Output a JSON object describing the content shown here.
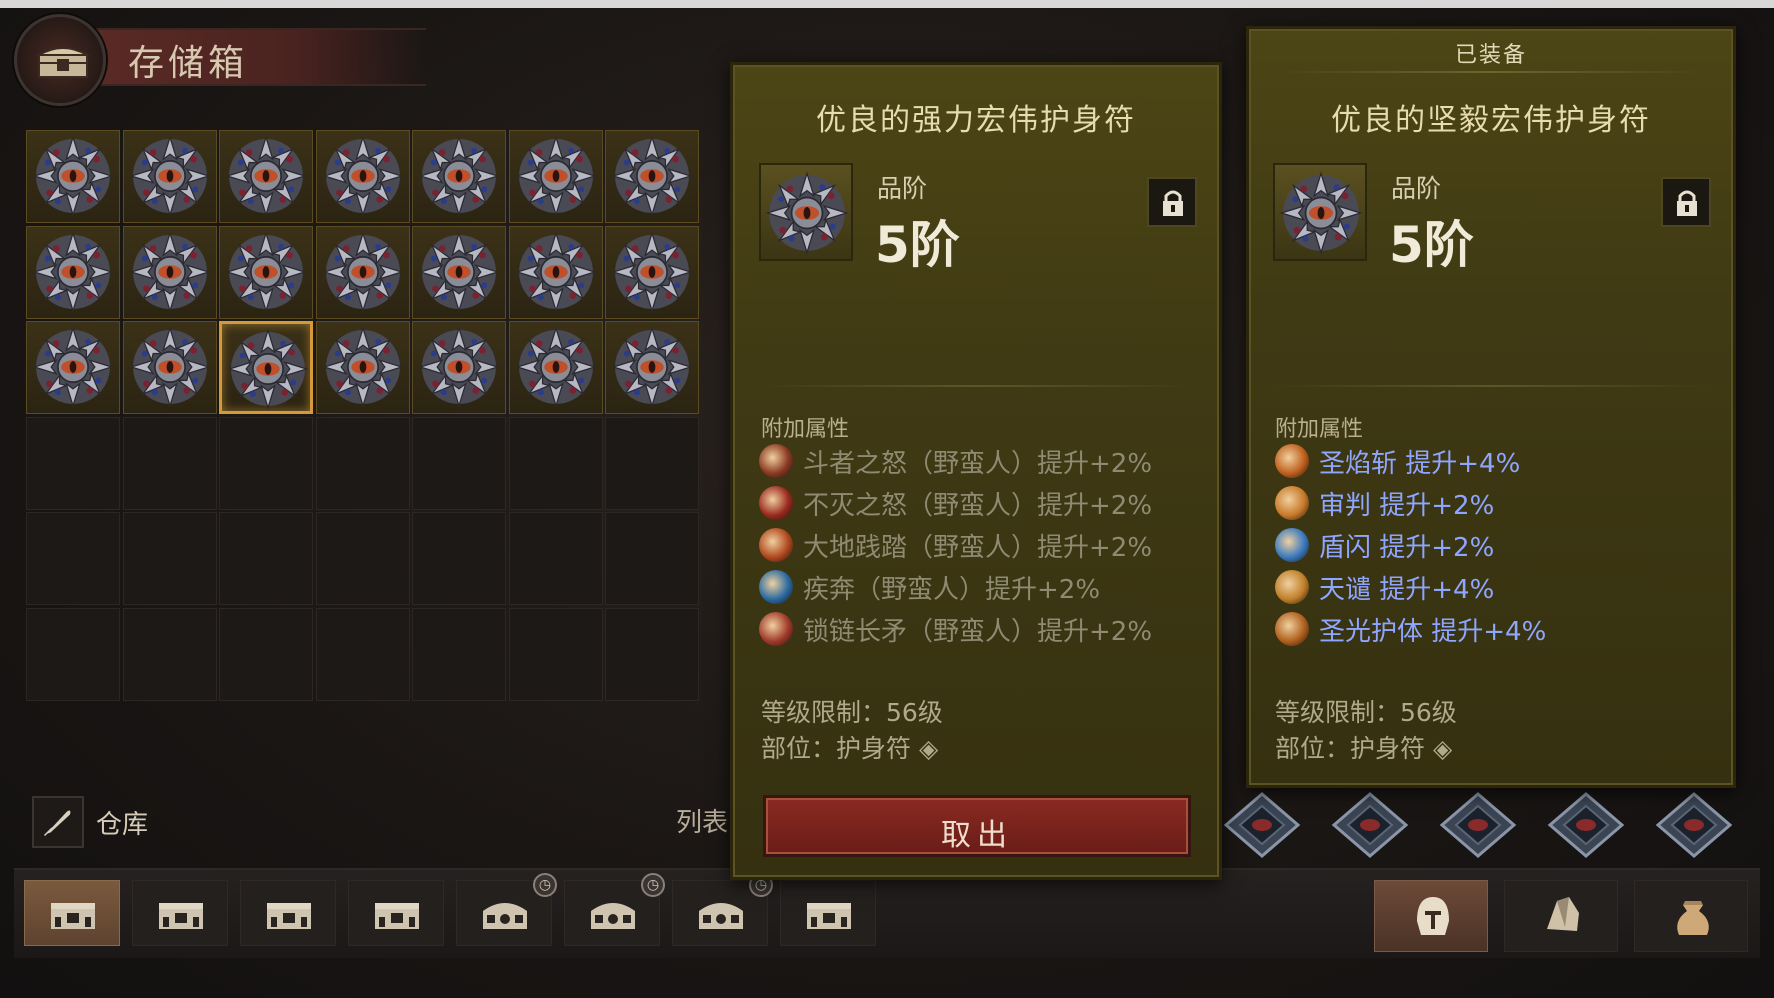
{
  "header": {
    "title": "存储箱",
    "icon": "chest-icon"
  },
  "grid": {
    "columns": 7,
    "rows": 6,
    "filled_rows": 3,
    "selected": {
      "row": 2,
      "col": 2
    },
    "item_icon": "amulet-icon"
  },
  "storage": {
    "label": "仓库",
    "list_label": "列表"
  },
  "tooltip_left": {
    "item_name": "优良的强力宏伟护身符",
    "grade_label": "品阶",
    "grade_value": "5阶",
    "attr_header": "附加属性",
    "attributes": [
      {
        "text": "斗者之怒（野蛮人）提升+2%",
        "color": "#8a3a22"
      },
      {
        "text": "不灭之怒（野蛮人）提升+2%",
        "color": "#9a2a1e"
      },
      {
        "text": "大地践踏（野蛮人）提升+2%",
        "color": "#b0481e"
      },
      {
        "text": "疾奔（野蛮人）提升+2%",
        "color": "#2a6aa0"
      },
      {
        "text": "锁链长矛（野蛮人）提升+2%",
        "color": "#a03a2a"
      }
    ],
    "level_req": "等级限制：56级",
    "slot": "部位：护身符",
    "action_label": "取出"
  },
  "tooltip_right": {
    "equipped_label": "已装备",
    "item_name": "优良的坚毅宏伟护身符",
    "grade_label": "品阶",
    "grade_value": "5阶",
    "attr_header": "附加属性",
    "attributes": [
      {
        "text": "圣焰斩  提升+4%",
        "color": "#c0601e"
      },
      {
        "text": "审判  提升+2%",
        "color": "#c87a2a"
      },
      {
        "text": "盾闪  提升+2%",
        "color": "#3a7ac0"
      },
      {
        "text": "天谴  提升+4%",
        "color": "#c0802a"
      },
      {
        "text": "圣光护体  提升+4%",
        "color": "#b0601e"
      }
    ],
    "level_req": "等级限制：56级",
    "slot": "部位：护身符"
  },
  "bottom_tabs": [
    {
      "icon": "chest-icon",
      "active": true,
      "timer": false
    },
    {
      "icon": "chest-icon",
      "active": false,
      "timer": false
    },
    {
      "icon": "chest-icon",
      "active": false,
      "timer": false
    },
    {
      "icon": "chest-icon",
      "active": false,
      "timer": false
    },
    {
      "icon": "ornate-chest-icon",
      "active": false,
      "timer": true
    },
    {
      "icon": "ornate-chest-icon",
      "active": false,
      "timer": true
    },
    {
      "icon": "ornate-chest-icon",
      "active": false,
      "timer": true
    },
    {
      "icon": "chest-icon",
      "active": false,
      "timer": false
    }
  ],
  "right_tabs": [
    {
      "icon": "helmet-icon",
      "active": true
    },
    {
      "icon": "crystal-icon",
      "active": false
    },
    {
      "icon": "bag-icon",
      "active": false
    }
  ],
  "colors": {
    "panel": "#443e14",
    "selected_border": "#d49a3a",
    "take_button": "#7a2420",
    "attr_blue": "#8fa6ff"
  }
}
